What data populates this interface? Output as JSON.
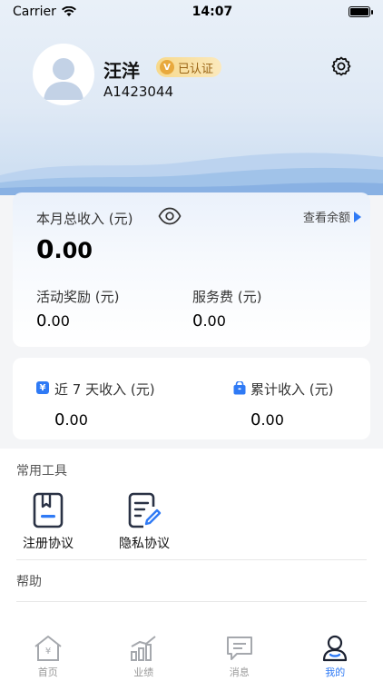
{
  "status_bar": {
    "carrier": "Carrier",
    "time": "14:07"
  },
  "profile": {
    "name": "汪洋",
    "verified_label": "已认证",
    "user_id": "A1423044"
  },
  "income_card": {
    "monthly_label": "本月总收入 (元)",
    "monthly_int": "0",
    "monthly_dec": ".00",
    "balance_link": "查看余额",
    "reward_label": "活动奖励 (元)",
    "reward_int": "0",
    "reward_dec": ".00",
    "fee_label": "服务费 (元)",
    "fee_int": "0",
    "fee_dec": ".00"
  },
  "stats_card": {
    "week_label": "近 7 天收入 (元)",
    "week_int": "0",
    "week_dec": ".00",
    "total_label": "累计收入 (元)",
    "total_int": "0",
    "total_dec": ".00",
    "week_icon_glyph": "¥"
  },
  "tools": {
    "section_title": "常用工具",
    "items": [
      {
        "label": "注册协议",
        "icon": "document-bookmark-icon"
      },
      {
        "label": "隐私协议",
        "icon": "document-edit-icon"
      }
    ]
  },
  "help": {
    "section_title": "帮助"
  },
  "tabbar": {
    "items": [
      {
        "label": "首页",
        "icon": "home-yen-icon"
      },
      {
        "label": "业绩",
        "icon": "bar-chart-icon"
      },
      {
        "label": "消息",
        "icon": "message-icon"
      },
      {
        "label": "我的",
        "icon": "profile-icon"
      }
    ],
    "active_color": "#2f7af5",
    "inactive_color": "#999999"
  },
  "colors": {
    "accent": "#2f7af5",
    "badge_gold": "#e8a93d"
  }
}
